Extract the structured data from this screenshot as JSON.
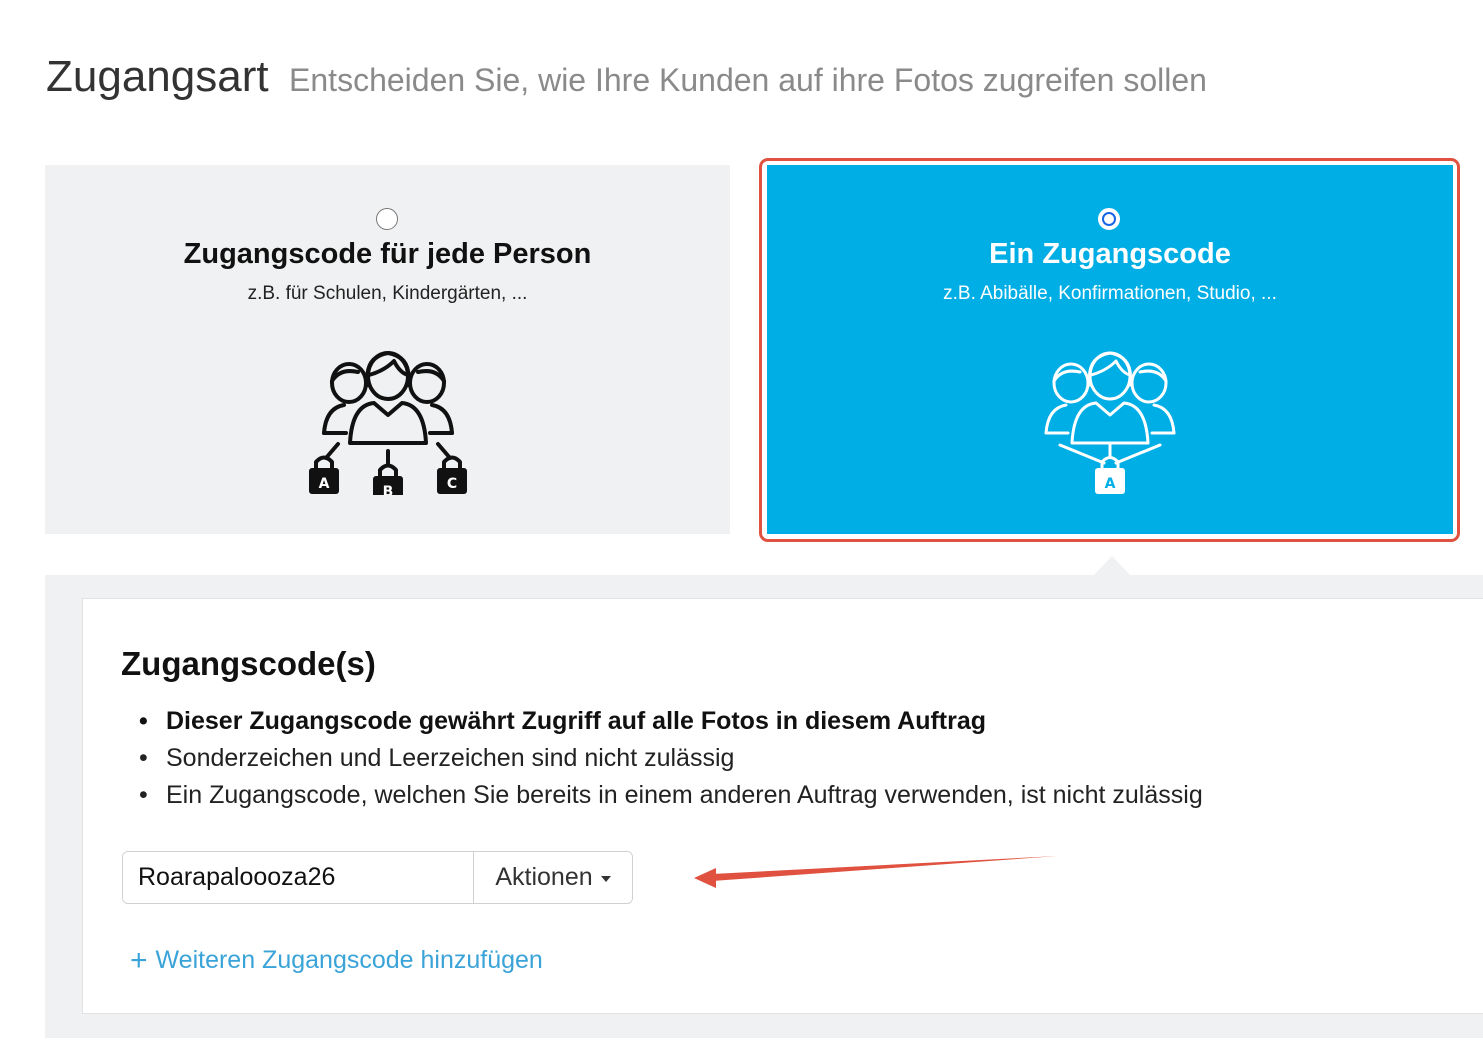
{
  "header": {
    "title": "Zugangsart",
    "subtitle": "Entscheiden Sie, wie Ihre Kunden auf ihre Fotos zugreifen sollen"
  },
  "options": [
    {
      "title": "Zugangscode für jede Person",
      "description": "z.B. für Schulen, Kindergärten, ...",
      "selected": false,
      "icon": "group-multiple-locks-icon",
      "lock_labels": [
        "A",
        "B",
        "C"
      ]
    },
    {
      "title": "Ein Zugangscode",
      "description": "z.B. Abibälle, Konfirmationen, Studio, ...",
      "selected": true,
      "icon": "group-single-lock-icon",
      "lock_labels": [
        "A"
      ]
    }
  ],
  "codes_section": {
    "title": "Zugangscode(s)",
    "rules": [
      "Dieser Zugangscode gewährt Zugriff auf alle Fotos in diesem Auftrag",
      "Sonderzeichen und Leerzeichen sind nicht zulässig",
      "Ein Zugangscode, welchen Sie bereits in einem anderen Auftrag verwenden, ist nicht zulässig"
    ],
    "code_value": "Roarapaloooza26",
    "actions_label": "Aktionen",
    "add_label": "Weiteren Zugangscode hinzufügen"
  },
  "colors": {
    "selected_card": "#00aee6",
    "unselected_card": "#f0f1f2",
    "highlight_border": "#e0523f",
    "annotation_arrow": "#e0523f",
    "link": "#3aa3d8",
    "radio_selected": "#1565e6"
  }
}
